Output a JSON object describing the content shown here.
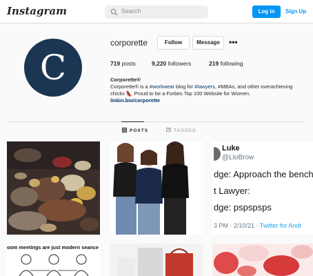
{
  "topbar": {
    "logo": "Instagram",
    "search_placeholder": "Search",
    "login_label": "Log in",
    "signup_label": "Sign Up"
  },
  "profile": {
    "avatar_letter": "C",
    "username": "corporette",
    "follow_label": "Follow",
    "message_label": "Message",
    "more_label": "•••",
    "posts_count": "719",
    "posts_label": "posts",
    "followers_count": "9,220",
    "followers_label": "followers",
    "following_count": "219",
    "following_label": "following",
    "bio": {
      "name": "Corporette®",
      "line1_a": "Corporette® is a ",
      "tag1": "#workwear",
      "line1_b": " blog for ",
      "tag2": "#lawyers",
      "line1_c": ", #MBAs, and other overachieving",
      "line2": "chicks 👠 Proud to be a Forbes Top 100 Website for Women.",
      "link": "linkin.bio/corporette"
    }
  },
  "tabs": {
    "posts": "POSTS",
    "tagged": "TAGGED"
  },
  "posts": {
    "tweet": {
      "name": "Luke",
      "handle": "@LloBrow",
      "line1": "dge: Approach the bench",
      "line2": "t Lawyer:",
      "line3": "dge: pspspsps",
      "meta_time": "3 PM · 2/10/21 · ",
      "meta_source": "Twitter for Andr"
    },
    "comic_caption": "oom meetings are just modern seance"
  },
  "colors": {
    "brand_blue": "#0095f6",
    "avatar_bg": "#1b3553",
    "link_color": "#00376b"
  }
}
